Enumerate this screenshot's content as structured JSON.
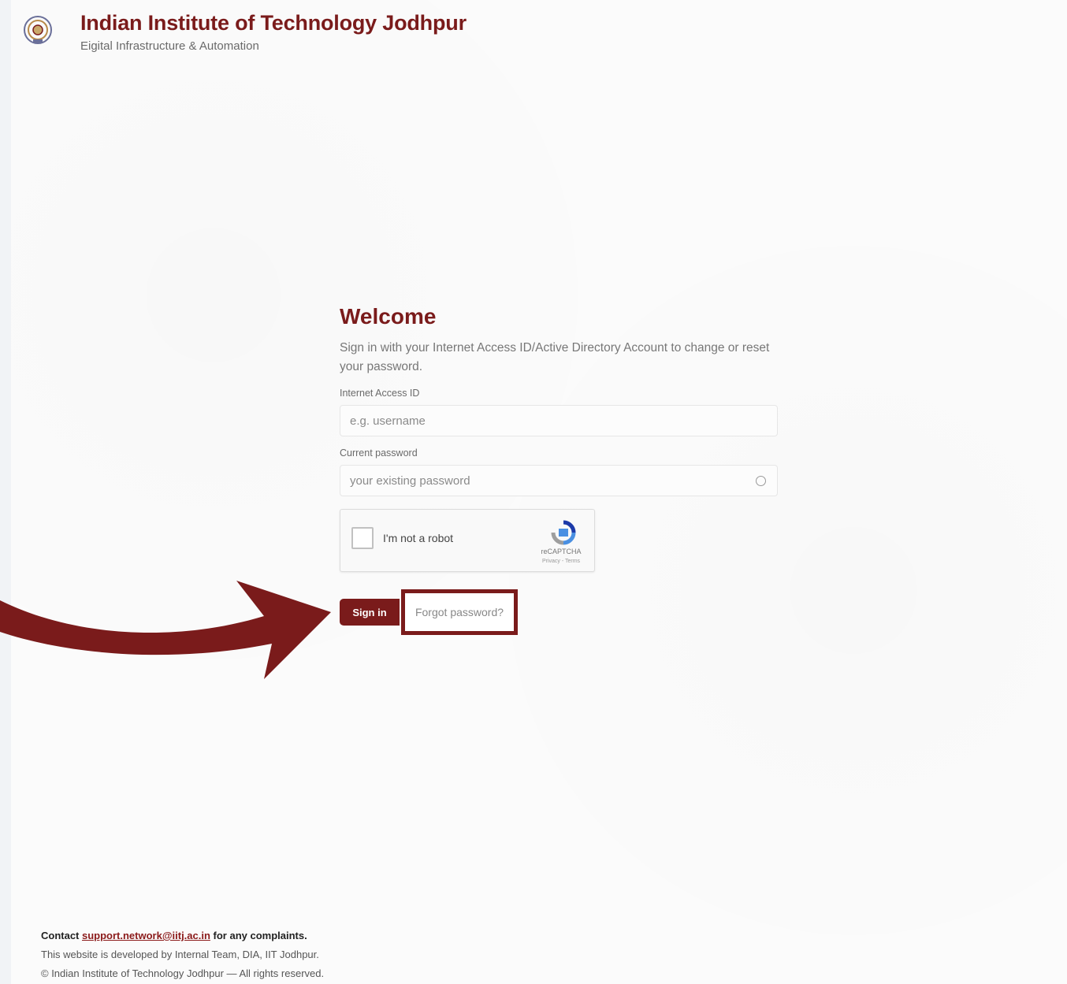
{
  "header": {
    "title": "Indian Institute of Technology Jodhpur",
    "subtitle": "Eigital Infrastructure & Automation",
    "logo_icon": "iit-jodhpur-emblem-icon"
  },
  "form": {
    "heading": "Welcome",
    "intro": "Sign in with your Internet Access ID/Active Directory Account to change or reset your password.",
    "username": {
      "label": "Internet Access ID",
      "placeholder": "e.g. username"
    },
    "password": {
      "label": "Current password",
      "placeholder": "your existing password",
      "toggle_icon": "eye-icon"
    },
    "captcha": {
      "label": "I'm not a robot",
      "brand": "reCAPTCHA",
      "links": "Privacy - Terms",
      "icon": "recaptcha-logo-icon"
    },
    "signin_label": "Sign in",
    "forgot_label": "Forgot password?"
  },
  "annotation": {
    "arrow_icon": "pointer-arrow-icon",
    "color": "#7a1b1b"
  },
  "footer": {
    "contact_prefix": "Contact ",
    "contact_email": "support.network@iitj.ac.in",
    "contact_suffix": " for any complaints.",
    "developed_by": "This website is developed by Internal Team, DIA, IIT Jodhpur.",
    "copyright": "© Indian Institute of Technology Jodhpur — All rights reserved."
  },
  "colors": {
    "brand": "#7a1b1b",
    "background": "#fbfbfb"
  }
}
